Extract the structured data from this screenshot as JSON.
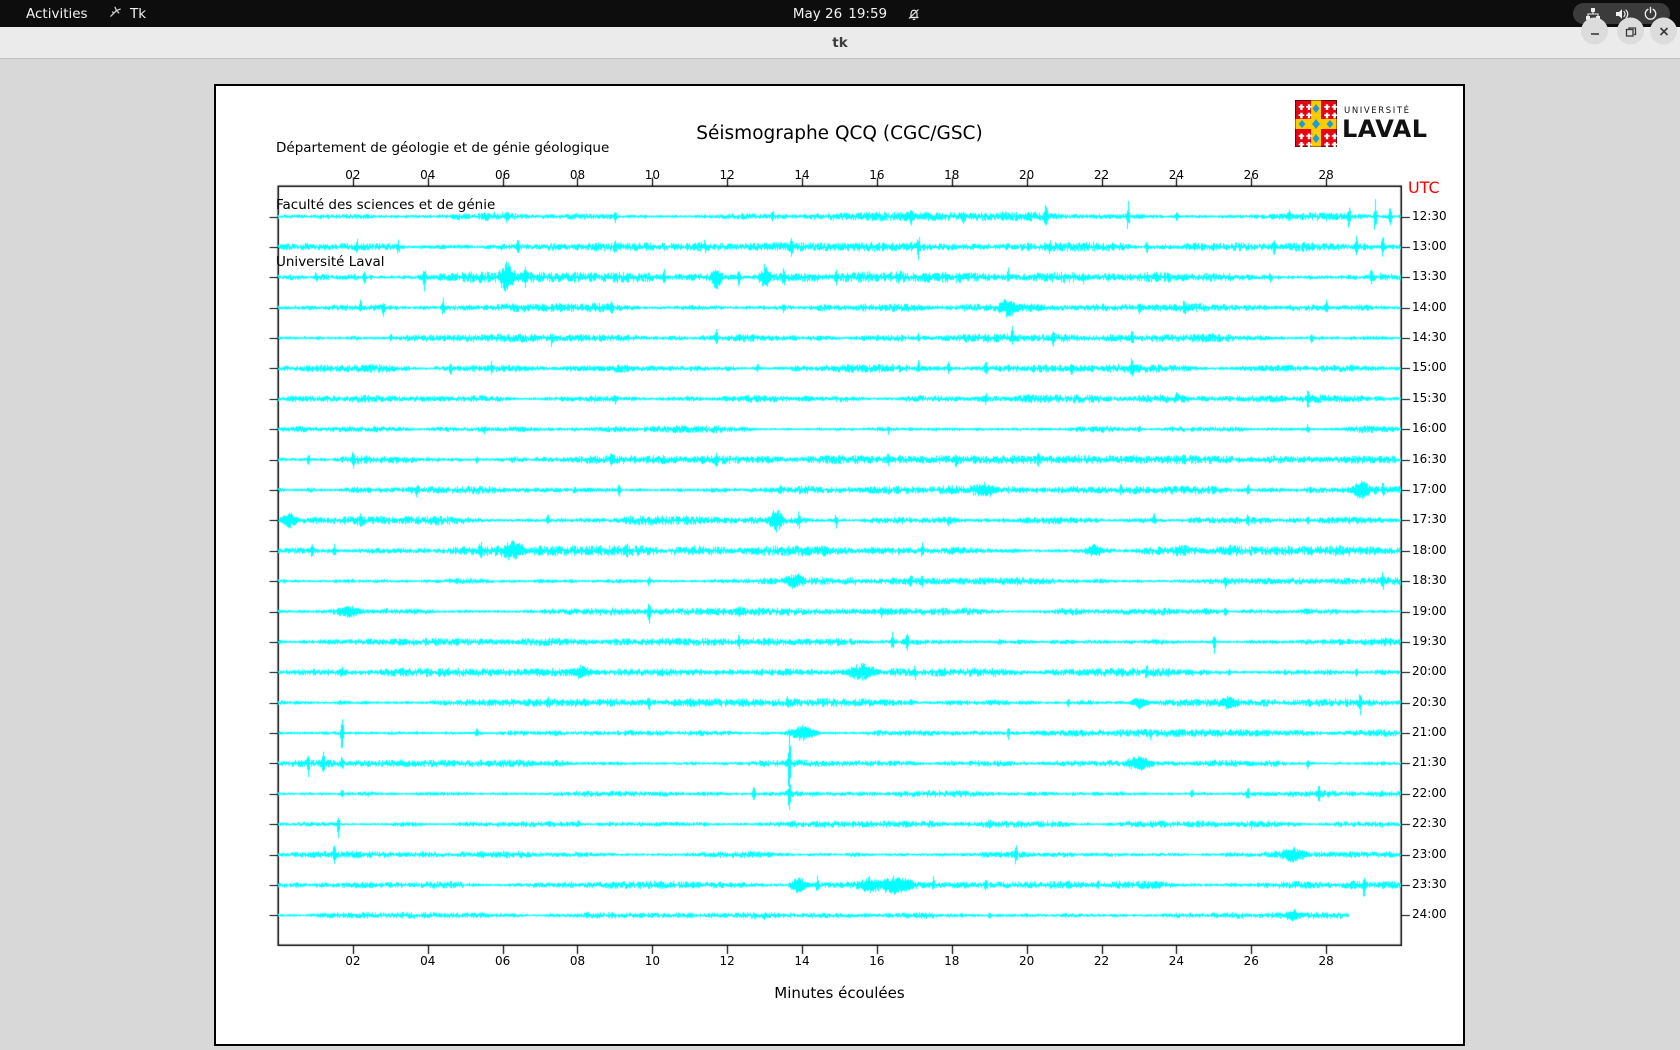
{
  "topbar": {
    "activities": "Activities",
    "app_name": "Tk",
    "clock_date": "May 26",
    "clock_time": "19:59"
  },
  "titlebar": {
    "title": "tk"
  },
  "document": {
    "address_lines": [
      "Département de géologie et de génie géologique",
      "Faculté des sciences et de génie",
      "Université Laval"
    ],
    "title": "Séismographe QCQ (CGC/GSC)",
    "logo": {
      "line1": "UNIVERSITÉ",
      "line2": "LAVAL"
    },
    "utc_label": "UTC",
    "xlabel": "Minutes écoulées"
  },
  "colors": {
    "trace": "#00ffff",
    "utc_label": "#ff0000",
    "plot_border": "#000000",
    "logo_red": "#e30613",
    "logo_yellow": "#ffcc00",
    "logo_blue": "#1e9cd7"
  },
  "chart_data": {
    "type": "line",
    "variant": "seismograph-helicorder",
    "title": "Séismographe QCQ (CGC/GSC)",
    "xlabel": "Minutes écoulées",
    "x_range_minutes": [
      0,
      30
    ],
    "x_ticks": [
      "02",
      "04",
      "06",
      "08",
      "10",
      "12",
      "14",
      "16",
      "18",
      "20",
      "22",
      "24",
      "26",
      "28"
    ],
    "x_tick_minutes": [
      2,
      4,
      6,
      8,
      10,
      12,
      14,
      16,
      18,
      20,
      22,
      24,
      26,
      28
    ],
    "right_axis_label": "UTC",
    "traces": [
      {
        "label": "12:30",
        "base": 1.9,
        "spikes": [
          [
            6.1,
            5
          ],
          [
            9.0,
            6
          ],
          [
            13.2,
            5
          ],
          [
            16.9,
            8
          ],
          [
            18.3,
            5
          ],
          [
            20.5,
            15
          ],
          [
            22.7,
            16
          ],
          [
            24.0,
            5
          ],
          [
            27.0,
            6
          ],
          [
            28.6,
            14
          ],
          [
            29.3,
            20
          ],
          [
            29.7,
            12
          ]
        ]
      },
      {
        "label": "13:00",
        "base": 1.9,
        "spikes": [
          [
            2.1,
            6
          ],
          [
            3.2,
            7
          ],
          [
            6.4,
            8
          ],
          [
            9.0,
            6
          ],
          [
            11.4,
            5
          ],
          [
            13.7,
            9
          ],
          [
            17.1,
            14
          ],
          [
            20.6,
            5
          ],
          [
            23.2,
            8
          ],
          [
            26.6,
            10
          ],
          [
            28.8,
            12
          ],
          [
            29.5,
            14
          ]
        ]
      },
      {
        "label": "13:30",
        "base": 2.3,
        "spikes": [
          [
            1.0,
            5
          ],
          [
            2.3,
            8
          ],
          [
            3.9,
            12
          ],
          [
            6.1,
            14,
            0.25
          ],
          [
            6.6,
            10
          ],
          [
            10.3,
            9
          ],
          [
            11.7,
            12,
            0.2
          ],
          [
            12.3,
            10
          ],
          [
            13.0,
            11,
            0.2
          ],
          [
            13.5,
            9
          ],
          [
            14.9,
            10
          ],
          [
            16.6,
            5
          ],
          [
            19.5,
            7
          ],
          [
            21.5,
            6
          ],
          [
            26.5,
            5
          ],
          [
            29.2,
            8
          ]
        ]
      },
      {
        "label": "14:00",
        "base": 1.9,
        "spikes": [
          [
            2.2,
            7
          ],
          [
            2.8,
            8
          ],
          [
            4.4,
            11
          ],
          [
            8.9,
            9
          ],
          [
            13.5,
            4
          ],
          [
            19.5,
            7,
            0.3
          ],
          [
            23.0,
            5
          ],
          [
            24.2,
            6
          ],
          [
            28.0,
            7
          ]
        ]
      },
      {
        "label": "14:30",
        "base": 1.8,
        "spikes": [
          [
            3.0,
            4
          ],
          [
            7.3,
            6
          ],
          [
            11.7,
            8
          ],
          [
            17.1,
            5
          ],
          [
            19.6,
            9
          ],
          [
            20.7,
            7
          ],
          [
            22.8,
            8
          ],
          [
            27.6,
            6
          ]
        ]
      },
      {
        "label": "15:00",
        "base": 1.7,
        "spikes": [
          [
            4.6,
            7
          ],
          [
            5.7,
            6
          ],
          [
            12.8,
            4
          ],
          [
            17.1,
            7
          ],
          [
            17.9,
            6
          ],
          [
            18.9,
            8
          ],
          [
            21.2,
            6
          ],
          [
            22.8,
            9
          ]
        ]
      },
      {
        "label": "15:30",
        "base": 1.7,
        "spikes": [
          [
            9.0,
            4
          ],
          [
            18.9,
            6
          ],
          [
            24.0,
            4
          ],
          [
            27.5,
            9
          ]
        ]
      },
      {
        "label": "16:00",
        "base": 1.5,
        "spikes": [
          [
            5.5,
            3
          ],
          [
            16.3,
            4
          ],
          [
            23.0,
            4
          ],
          [
            27.5,
            5
          ]
        ]
      },
      {
        "label": "16:30",
        "base": 1.8,
        "spikes": [
          [
            0.8,
            6
          ],
          [
            2.0,
            8
          ],
          [
            5.3,
            4
          ],
          [
            8.9,
            6
          ],
          [
            11.7,
            7
          ],
          [
            16.3,
            6
          ],
          [
            18.1,
            6
          ],
          [
            20.3,
            5
          ],
          [
            24.2,
            4
          ]
        ]
      },
      {
        "label": "17:00",
        "base": 1.8,
        "spikes": [
          [
            3.7,
            7
          ],
          [
            9.1,
            8
          ],
          [
            13.4,
            4
          ],
          [
            18.9,
            6,
            0.4
          ],
          [
            22.5,
            4
          ],
          [
            25.9,
            7
          ],
          [
            28.9,
            8,
            0.3
          ],
          [
            29.5,
            6
          ]
        ]
      },
      {
        "label": "17:30",
        "base": 2.0,
        "spikes": [
          [
            0.3,
            8,
            0.3
          ],
          [
            2.2,
            5
          ],
          [
            7.2,
            7
          ],
          [
            10.9,
            5
          ],
          [
            13.3,
            12,
            0.25
          ],
          [
            13.9,
            10
          ],
          [
            14.9,
            8
          ],
          [
            17.9,
            4
          ],
          [
            23.4,
            6
          ],
          [
            25.9,
            6
          ],
          [
            27.5,
            5
          ]
        ]
      },
      {
        "label": "18:00",
        "base": 2.2,
        "spikes": [
          [
            0.9,
            8
          ],
          [
            1.5,
            6
          ],
          [
            5.4,
            7
          ],
          [
            6.3,
            9,
            0.4
          ],
          [
            9.3,
            7
          ],
          [
            14.6,
            5
          ],
          [
            17.2,
            8
          ],
          [
            21.8,
            6,
            0.3
          ],
          [
            25.4,
            4
          ]
        ]
      },
      {
        "label": "18:30",
        "base": 1.7,
        "spikes": [
          [
            9.9,
            5
          ],
          [
            13.8,
            7,
            0.3
          ],
          [
            16.9,
            6
          ],
          [
            17.2,
            5
          ],
          [
            25.3,
            6
          ],
          [
            29.5,
            9
          ]
        ]
      },
      {
        "label": "19:00",
        "base": 1.6,
        "spikes": [
          [
            1.9,
            5,
            0.4
          ],
          [
            9.9,
            13
          ],
          [
            12.3,
            4
          ],
          [
            16.1,
            4
          ],
          [
            25.3,
            5
          ]
        ]
      },
      {
        "label": "19:30",
        "base": 1.6,
        "spikes": [
          [
            12.3,
            7
          ],
          [
            16.4,
            10
          ],
          [
            16.8,
            11
          ],
          [
            25.0,
            12
          ]
        ]
      },
      {
        "label": "20:00",
        "base": 1.8,
        "spikes": [
          [
            1.7,
            4
          ],
          [
            8.1,
            6,
            0.25
          ],
          [
            15.6,
            7,
            0.5
          ],
          [
            17.0,
            6
          ],
          [
            17.8,
            4
          ],
          [
            23.2,
            6
          ],
          [
            25.4,
            4
          ],
          [
            28.8,
            5
          ]
        ]
      },
      {
        "label": "20:30",
        "base": 1.7,
        "spikes": [
          [
            7.2,
            6
          ],
          [
            9.9,
            7
          ],
          [
            13.6,
            5
          ],
          [
            16.9,
            4
          ],
          [
            21.1,
            5
          ],
          [
            23.0,
            6,
            0.3
          ],
          [
            25.4,
            6,
            0.3
          ],
          [
            28.9,
            14
          ]
        ]
      },
      {
        "label": "21:00",
        "base": 1.6,
        "spikes": [
          [
            1.7,
            24
          ],
          [
            5.3,
            5
          ],
          [
            14.0,
            8,
            0.5
          ],
          [
            19.5,
            7
          ],
          [
            23.3,
            5
          ]
        ]
      },
      {
        "label": "21:30",
        "base": 1.5,
        "spikes": [
          [
            0.8,
            12
          ],
          [
            1.2,
            13
          ],
          [
            1.7,
            6
          ],
          [
            13.65,
            40
          ],
          [
            23.0,
            7,
            0.4
          ],
          [
            27.5,
            5
          ]
        ]
      },
      {
        "label": "22:00",
        "base": 1.5,
        "spikes": [
          [
            1.7,
            4
          ],
          [
            12.7,
            10
          ],
          [
            13.65,
            18
          ],
          [
            24.4,
            5
          ],
          [
            25.9,
            6
          ],
          [
            27.8,
            8
          ]
        ]
      },
      {
        "label": "22:30",
        "base": 1.4,
        "spikes": [
          [
            1.6,
            14
          ],
          [
            8.0,
            3
          ],
          [
            19.0,
            3
          ],
          [
            26.0,
            3
          ]
        ]
      },
      {
        "label": "23:00",
        "base": 1.4,
        "spikes": [
          [
            1.5,
            12
          ],
          [
            19.7,
            10
          ],
          [
            27.1,
            6,
            0.4
          ]
        ]
      },
      {
        "label": "23:30",
        "base": 1.7,
        "spikes": [
          [
            13.9,
            8,
            0.3
          ],
          [
            14.4,
            7
          ],
          [
            15.8,
            6,
            0.3
          ],
          [
            16.5,
            8,
            0.6
          ],
          [
            17.5,
            7
          ],
          [
            18.9,
            6
          ],
          [
            21.9,
            5
          ],
          [
            29.0,
            12
          ]
        ]
      },
      {
        "label": "24:00",
        "base": 1.3,
        "end": 28.6,
        "spikes": [
          [
            13.0,
            3
          ],
          [
            19.0,
            3
          ],
          [
            27.1,
            4,
            0.3
          ]
        ]
      }
    ]
  }
}
